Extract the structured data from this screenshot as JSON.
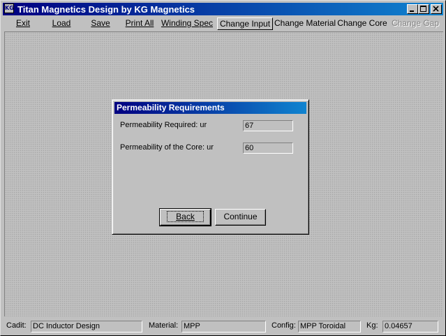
{
  "window": {
    "title": "Titan Magnetics Design by KG Magnetics",
    "icon_text": "KG",
    "controls": {
      "minimize": "minimize-icon",
      "maximize": "maximize-icon",
      "close": "close-icon"
    }
  },
  "toolbar": {
    "items": [
      {
        "label": "Exit",
        "state": "normal"
      },
      {
        "label": "Load",
        "state": "normal"
      },
      {
        "label": "Save",
        "state": "normal"
      },
      {
        "label": "Print All",
        "state": "normal"
      },
      {
        "label": "Winding Spec",
        "state": "normal"
      },
      {
        "label": "Change Input",
        "state": "active"
      },
      {
        "label": "Change Material",
        "state": "normal"
      },
      {
        "label": "Change Core",
        "state": "normal"
      },
      {
        "label": "Change Gap",
        "state": "disabled"
      }
    ]
  },
  "dialog": {
    "title": "Permeability Requirements",
    "required_label": "Permeability Required: ur",
    "required_value": "67",
    "core_label": "Permeability of the Core: ur",
    "core_value": "60",
    "back_label": "Back",
    "continue_label": "Continue"
  },
  "statusbar": {
    "cadit_label": "Cadit:",
    "cadit_value": "DC Inductor Design",
    "material_label": "Material:",
    "material_value": "MPP",
    "config_label": "Config:",
    "config_value": "MPP Toroidal",
    "kg_label": "Kg:",
    "kg_value": "0.04657"
  }
}
